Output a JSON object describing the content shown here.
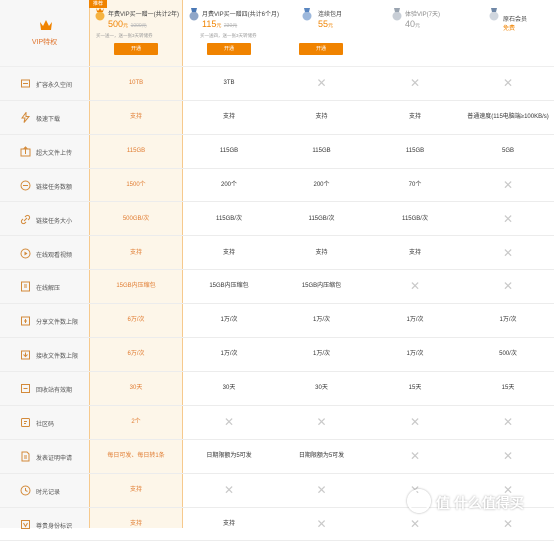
{
  "header": {
    "vip_title": "VIP特权",
    "badge": "推荐",
    "plans": [
      {
        "name": "年费VIP买一赠一(共计2年)",
        "price": "500",
        "unit": "元",
        "original": "1000元",
        "note": "买一送一，送一张3天转储券",
        "button": "开通",
        "icon": "crown-medal-icon"
      },
      {
        "name": "月费VIP买一赠四(共计6个月)",
        "price": "115",
        "unit": "元",
        "original": "230元",
        "note": "买一送四，送一张3天转储券",
        "button": "开通",
        "icon": "silver-medal-icon"
      },
      {
        "name": "连续包月",
        "price": "55",
        "unit": "元",
        "original": "",
        "note": "",
        "button": "开通",
        "icon": "blue-medal-icon"
      },
      {
        "name": "体验VIP(7天)",
        "price": "40",
        "unit": "元",
        "original": "",
        "note": "",
        "button": "",
        "icon": "gray-medal-icon"
      },
      {
        "name": "原石会员",
        "price": "免费",
        "unit": "",
        "original": "",
        "note": "",
        "button": "",
        "icon": "stone-medal-icon"
      }
    ]
  },
  "features": [
    {
      "label": "扩容永久空间",
      "icon": "storage-icon",
      "values": [
        "10TB",
        "3TB",
        "x",
        "x",
        "x"
      ]
    },
    {
      "label": "极速下载",
      "icon": "lightning-icon",
      "values": [
        "支持",
        "支持",
        "支持",
        "支持",
        "普通速度(115电脑端≥100KB/s)"
      ]
    },
    {
      "label": "超大文件上传",
      "icon": "upload-box-icon",
      "values": [
        "115GB",
        "115GB",
        "115GB",
        "115GB",
        "5GB"
      ]
    },
    {
      "label": "链接任务数额",
      "icon": "chain-icon",
      "values": [
        "1500个",
        "200个",
        "200个",
        "70个",
        "x"
      ]
    },
    {
      "label": "链接任务大小",
      "icon": "link-icon",
      "values": [
        "500GB/次",
        "115GB/次",
        "115GB/次",
        "115GB/次",
        "x"
      ]
    },
    {
      "label": "在线观看视频",
      "icon": "video-icon",
      "values": [
        "支持",
        "支持",
        "支持",
        "支持",
        "x"
      ]
    },
    {
      "label": "在线解压",
      "icon": "unzip-icon",
      "values": [
        "15GB内压缩包",
        "15GB内压缩包",
        "15GB内压缩包",
        "x",
        "x"
      ]
    },
    {
      "label": "分享文件数上限",
      "icon": "share-icon",
      "values": [
        "6万/次",
        "1万/次",
        "1万/次",
        "1万/次",
        "1万/次"
      ]
    },
    {
      "label": "接收文件数上限",
      "icon": "receive-icon",
      "values": [
        "6万/次",
        "1万/次",
        "1万/次",
        "1万/次",
        "500/次"
      ]
    },
    {
      "label": "回收站有效期",
      "icon": "recycle-icon",
      "values": [
        "30天",
        "30天",
        "30天",
        "15天",
        "15天"
      ]
    },
    {
      "label": "社区码",
      "icon": "community-icon",
      "values": [
        "2个",
        "x",
        "x",
        "x",
        "x"
      ]
    },
    {
      "label": "发表证明申请",
      "icon": "certificate-icon",
      "values": [
        "每日可发、每日转1条",
        "日期限额为5可发",
        "日期限额为5可发",
        "x",
        "x"
      ]
    },
    {
      "label": "时光记录",
      "icon": "clock-icon",
      "values": [
        "支持",
        "x",
        "x",
        "x",
        "x"
      ]
    },
    {
      "label": "尊贵身份标识",
      "icon": "vip-badge-icon",
      "values": [
        "支持",
        "支持",
        "x",
        "x",
        "x"
      ]
    }
  ],
  "watermark": {
    "text": "值 什么值得买"
  },
  "colors": {
    "accent": "#f08300",
    "year_bg": "#fdf6e9",
    "x_mark": "#c9c9c9"
  }
}
